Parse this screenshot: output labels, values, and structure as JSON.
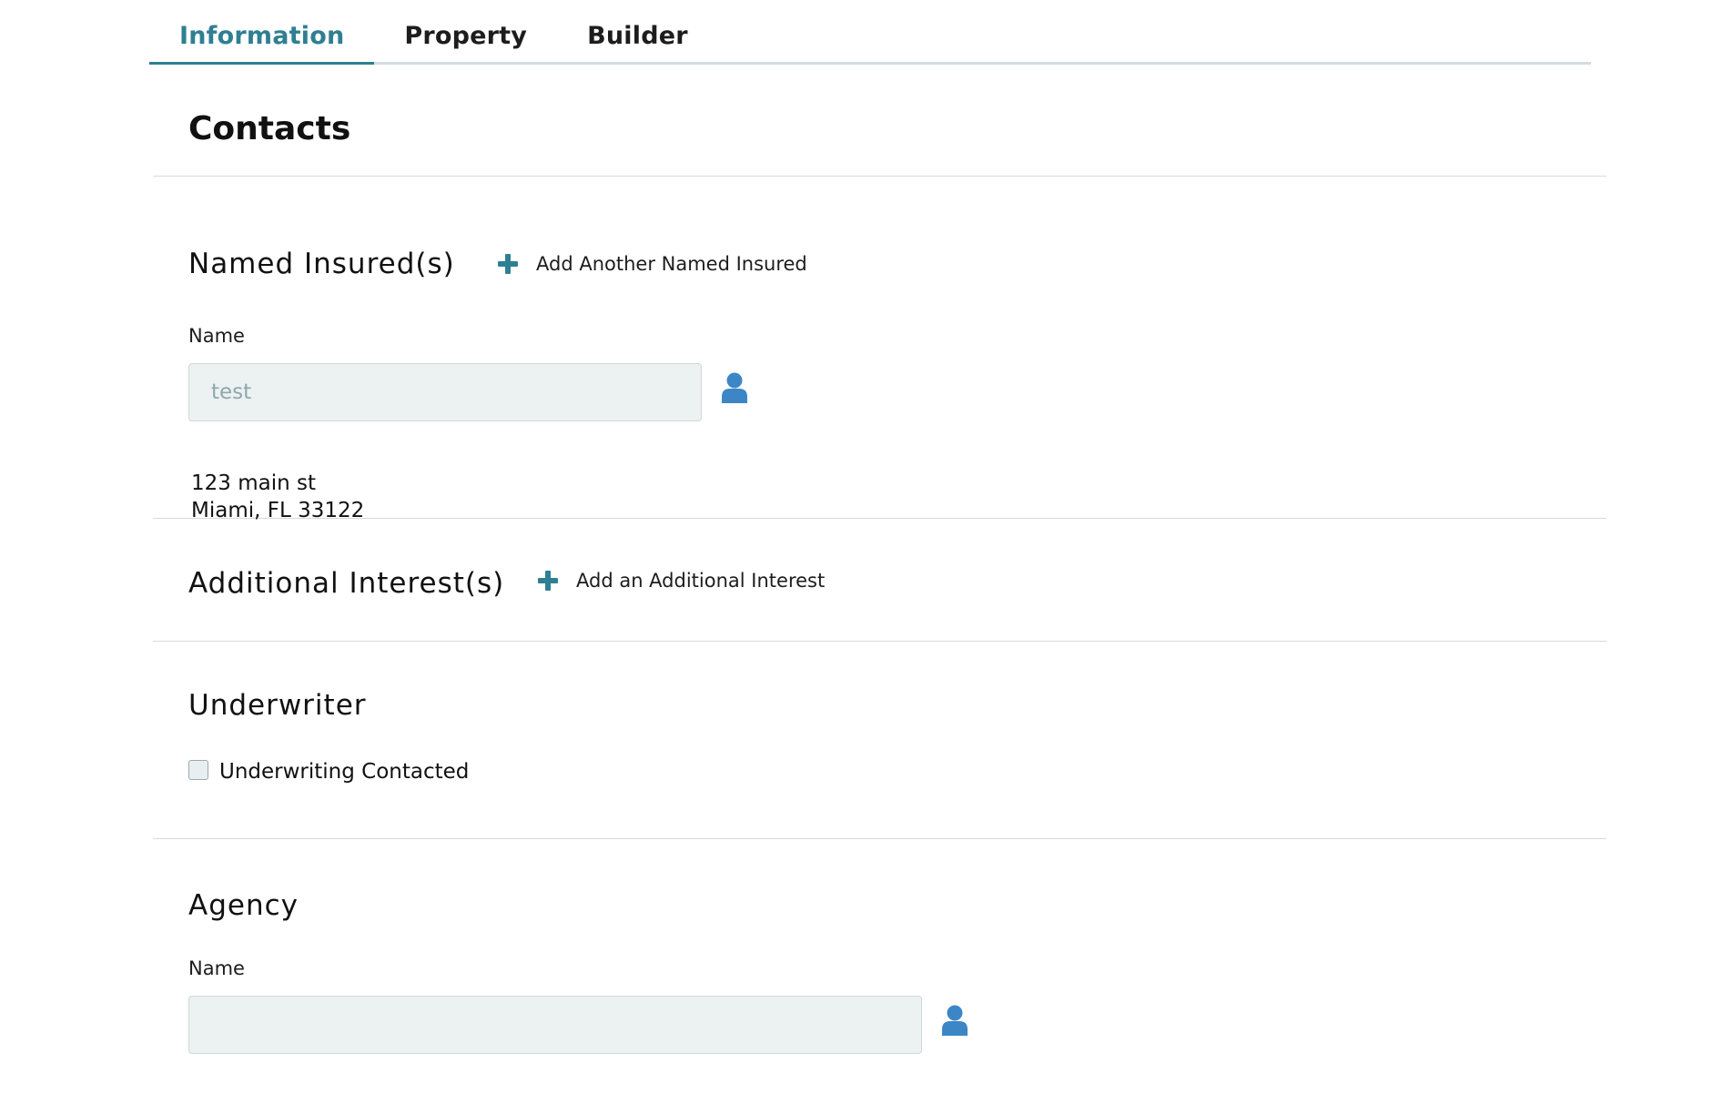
{
  "tabs": [
    {
      "label": "Information",
      "active": true
    },
    {
      "label": "Property",
      "active": false
    },
    {
      "label": "Builder",
      "active": false
    }
  ],
  "page_title": "Contacts",
  "named_insured": {
    "title": "Named Insured(s)",
    "add_label": "Add Another Named Insured",
    "name_label": "Name",
    "name_placeholder": "test",
    "name_value": "",
    "address_line1": "123 main st",
    "address_line2": "Miami, FL 33122"
  },
  "additional_interest": {
    "title": "Additional Interest(s)",
    "add_label": "Add an Additional Interest"
  },
  "underwriter": {
    "title": "Underwriter",
    "checkbox_label": "Underwriting Contacted",
    "checked": false
  },
  "agency": {
    "title": "Agency",
    "name_label": "Name",
    "name_value": ""
  },
  "colors": {
    "accent": "#2f7f93",
    "icon": "#3d86c6",
    "input_bg": "#ecf1f1"
  },
  "icons": {
    "add": "plus-icon",
    "contact_lookup": "person-icon"
  }
}
